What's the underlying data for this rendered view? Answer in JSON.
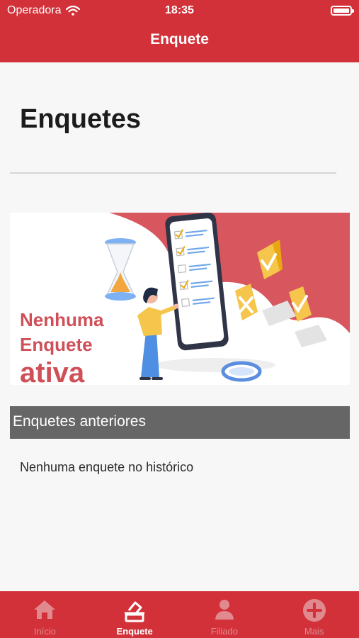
{
  "status_bar": {
    "carrier": "Operadora",
    "time": "18:35"
  },
  "header": {
    "title": "Enquete"
  },
  "main": {
    "page_title": "Enquetes",
    "banner": {
      "lines": [
        "Nenhuma",
        "Enquete",
        "ativa"
      ]
    },
    "previous_section_title": "Enquetes anteriores",
    "empty_history": "Nenhuma enquete no histórico"
  },
  "tabbar": {
    "items": [
      {
        "label": "Início",
        "icon": "home-icon"
      },
      {
        "label": "Enquete",
        "icon": "ballot-icon"
      },
      {
        "label": "Filiado",
        "icon": "person-icon"
      },
      {
        "label": "Mais",
        "icon": "plus-circle-icon"
      }
    ],
    "active": "Enquete"
  },
  "colors": {
    "brand_red": "#d23139",
    "section_gray": "#666666",
    "inactive_tab": "#e08a8f"
  }
}
